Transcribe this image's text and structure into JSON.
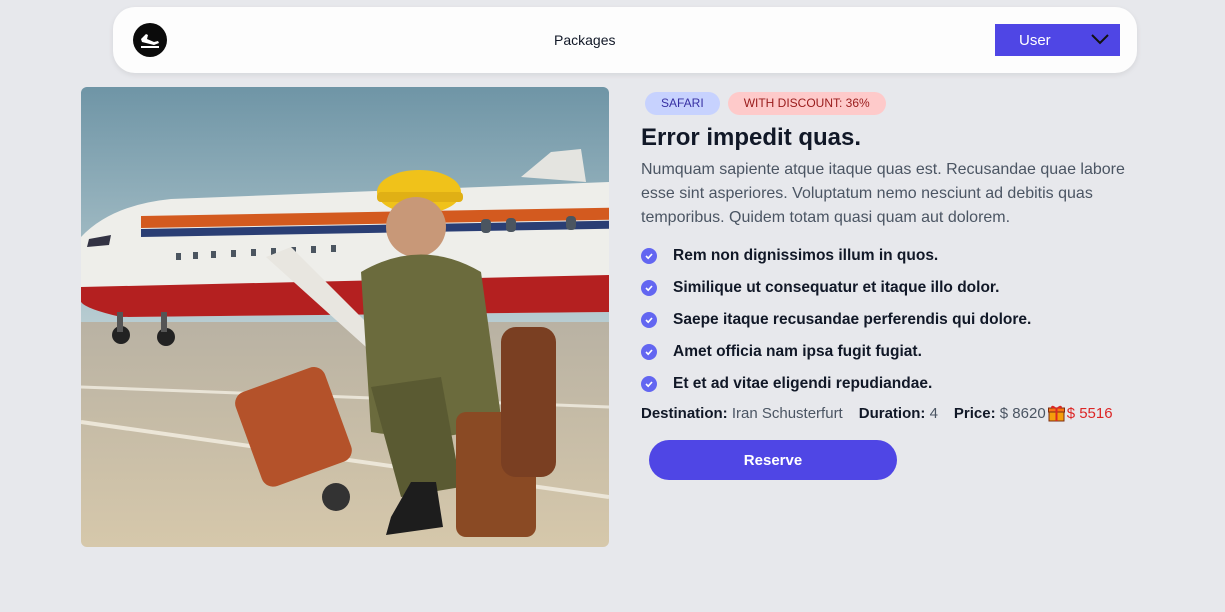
{
  "navbar": {
    "logo_icon": "plane-landing-icon",
    "packages_label": "Packages",
    "user_label": "User"
  },
  "hero": {
    "image_alt": ""
  },
  "package": {
    "badges": {
      "category": "SAFARI",
      "discount": "WITH DISCOUNT: 36%"
    },
    "title": "Error impedit quas.",
    "description": "Numquam sapiente atque itaque quas est. Recusandae quae labore esse sint asperiores. Voluptatum nemo nesciunt ad debitis quas temporibus. Quidem totam quasi quam aut dolorem.",
    "features": [
      "Rem non dignissimos illum in quos.",
      "Similique ut consequatur et itaque illo dolor.",
      "Saepe itaque recusandae perferendis qui dolore.",
      "Amet officia nam ipsa fugit fugiat.",
      "Et et ad vitae eligendi repudiandae."
    ],
    "destination_label": "Destination:",
    "destination": "Iran Schusterfurt",
    "duration_label": "Duration:",
    "duration": "4",
    "price_label": "Price:",
    "old_price": "$ 8620",
    "new_price": "$ 5516",
    "reserve_label": "Reserve"
  },
  "colors": {
    "accent": "#4f46e5",
    "badge_safari_bg": "#c7d2fe",
    "badge_discount_bg": "#fecaca",
    "discount_price": "#dc2626"
  }
}
